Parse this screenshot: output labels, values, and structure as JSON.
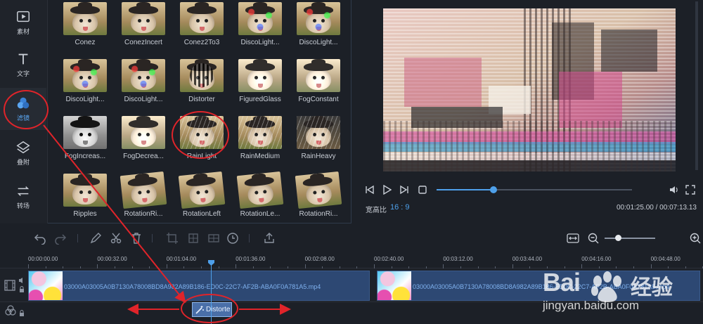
{
  "sidebar": {
    "items": [
      {
        "label": "素材",
        "icon": "media-icon"
      },
      {
        "label": "文字",
        "icon": "text-icon"
      },
      {
        "label": "滤镜",
        "icon": "filter-icon",
        "active": true
      },
      {
        "label": "叠附",
        "icon": "overlay-icon"
      },
      {
        "label": "转场",
        "icon": "transition-icon"
      }
    ]
  },
  "filters": {
    "items": [
      "Conez",
      "ConezIncert",
      "Conez2To3",
      "DiscoLight...",
      "DiscoLight...",
      "DiscoLight...",
      "DiscoLight...",
      "Distorter",
      "FiguredGlass",
      "FogConstant",
      "FogIncreas...",
      "FogDecrea...",
      "RainLight",
      "RainMedium",
      "RainHeavy",
      "Ripples",
      "RotationRi...",
      "RotationLeft",
      "RotationLe...",
      "RotationRi..."
    ]
  },
  "preview": {
    "aspect_label": "宽高比",
    "aspect_value": "16 : 9",
    "time": "00:01:25.00 / 00:07:13.13",
    "progress": 0.29
  },
  "timeline": {
    "ruler": [
      "00:00:00.00",
      "00:00:32.00",
      "00:01:04.00",
      "00:01:36.00",
      "00:02:08.00",
      "00:02:40.00",
      "00:03:12.00",
      "00:03:44.00",
      "00:04:16.00",
      "00:04:48.00"
    ],
    "clip1_name": "03000A03005A0B7130A78008BD8A982A89B186-ED0C-22C7-AF2B-ABA0F0A781A5.mp4",
    "clip2_name": "03000A03005A0B7130A78008BD8A982A89B186-ED0C-22C7-AF2B-ABA0F0A781A5.mp4",
    "filter_clip": "Distorte"
  },
  "watermark": {
    "brand": "Bai",
    "brand_cn": "经验",
    "url": "jingyan.baidu.com"
  },
  "colors": {
    "accent": "#4ea0ea",
    "annotation": "#e0242a"
  }
}
